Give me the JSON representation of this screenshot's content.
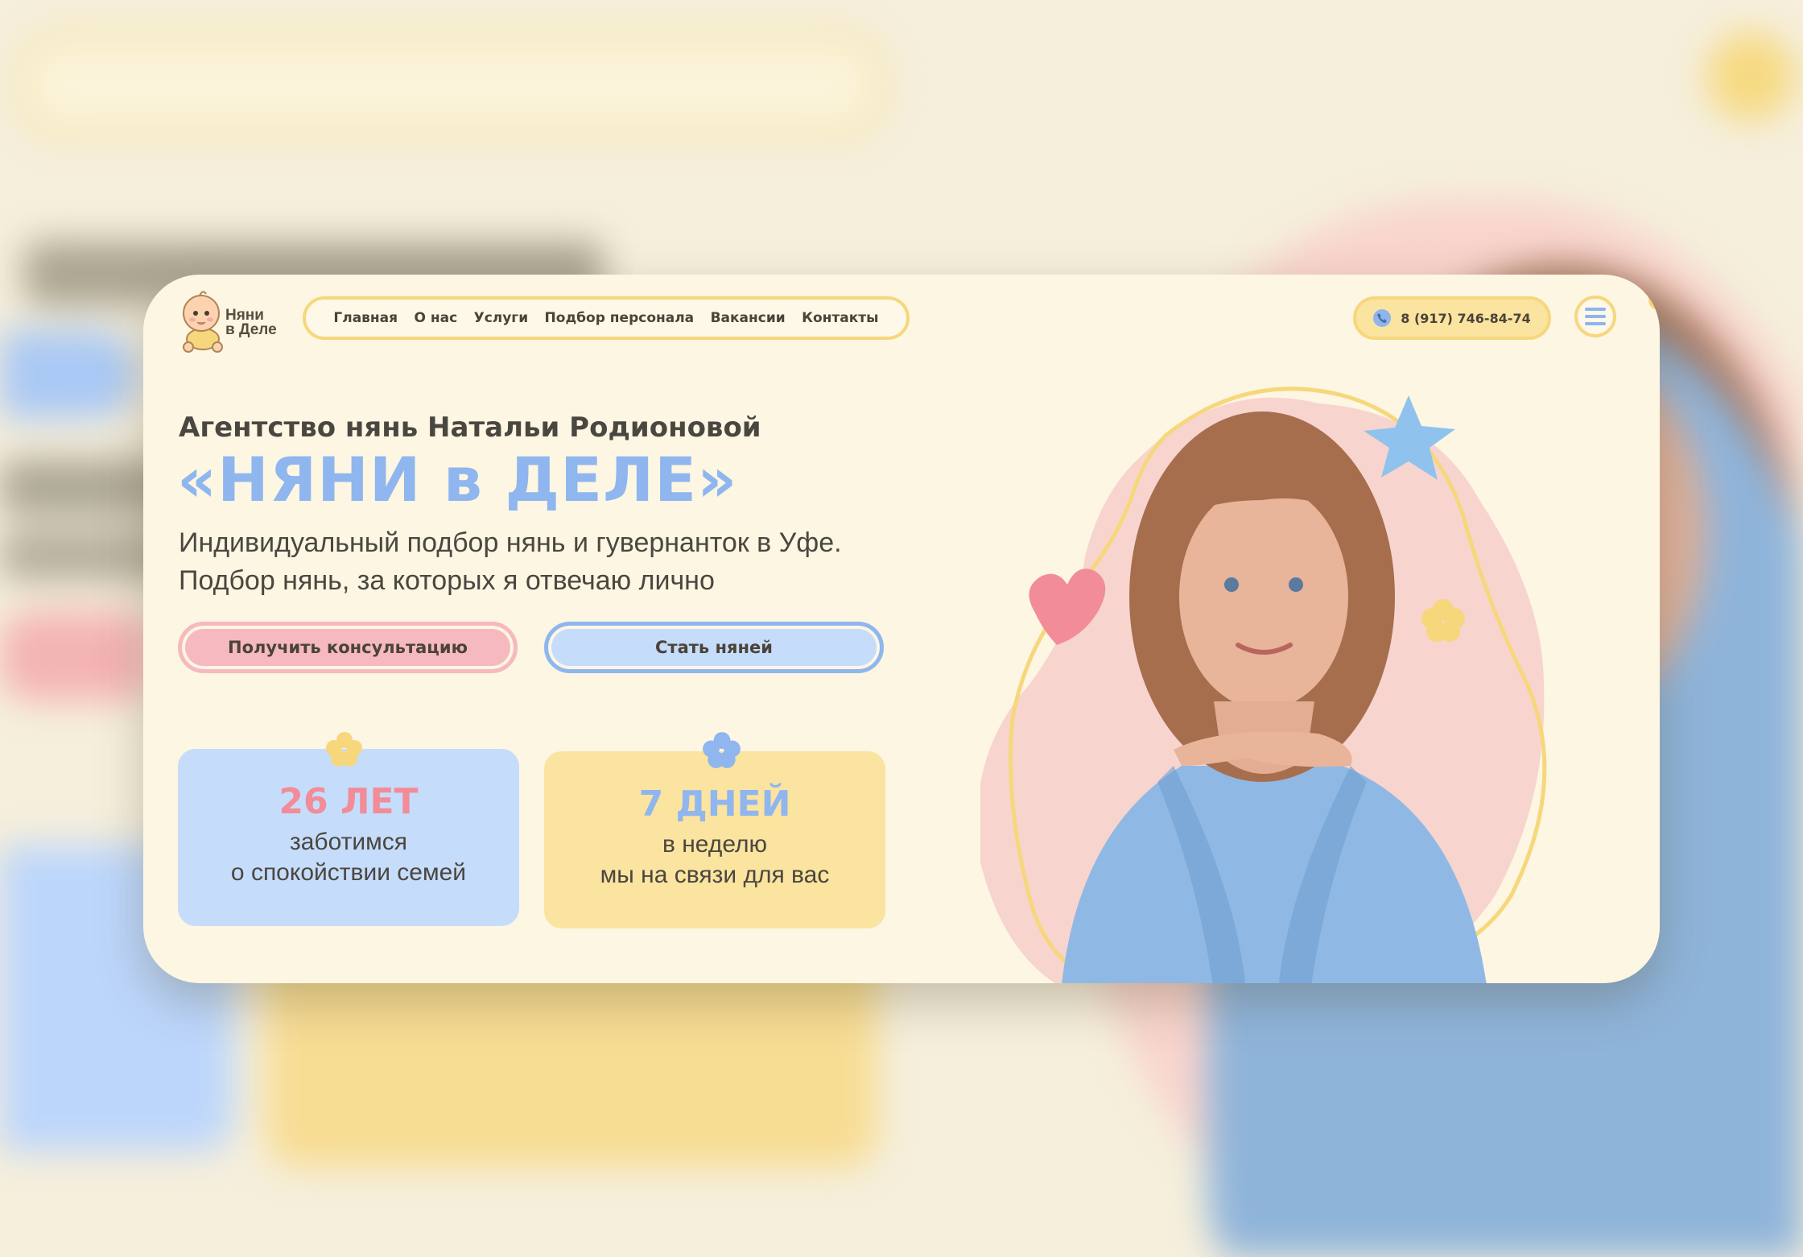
{
  "logo": {
    "line1": "Няни",
    "line2": "в Деле"
  },
  "nav": {
    "items": [
      {
        "label": "Главная"
      },
      {
        "label": "О нас"
      },
      {
        "label": "Услуги"
      },
      {
        "label": "Подбор персонала"
      },
      {
        "label": "Вакансии"
      },
      {
        "label": "Контакты"
      }
    ]
  },
  "header": {
    "phone": "8 (917) 746-84-74"
  },
  "hero": {
    "subtitle": "Агентство нянь Натальи Родионовой",
    "title": "«НЯНИ в ДЕЛЕ»",
    "description_line1": "Индивидуальный подбор нянь и гувернанток в Уфе.",
    "description_line2": "Подбор нянь, за которых я отвечаю лично",
    "cta_primary": "Получить консультацию",
    "cta_secondary": "Стать няней"
  },
  "stats": [
    {
      "value": "26 ЛЕТ",
      "line1": "заботимся",
      "line2": "о спокойствии семей"
    },
    {
      "value": "7 ДНЕЙ",
      "line1": "в неделю",
      "line2": "мы на связи для вас"
    }
  ],
  "colors": {
    "background": "#fcf6e3",
    "accent_yellow": "#f6d77c",
    "accent_blue": "#8fb6ee",
    "accent_pink": "#f6b9c0",
    "text_dark": "#4a4740"
  }
}
